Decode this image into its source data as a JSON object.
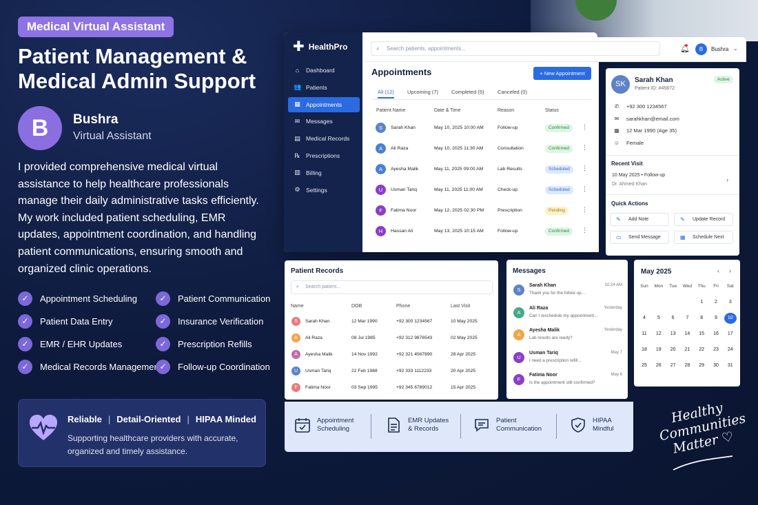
{
  "promo": {
    "tag": "Medical Virtual Assistant",
    "headline": "Patient Management & Medical Admin Support",
    "profile": {
      "initial": "B",
      "name": "Bushra",
      "role": "Virtual Assistant"
    },
    "description": "I provided comprehensive medical virtual assistance to help healthcare professionals manage their daily administrative tasks efficiently. My work included patient scheduling, EMR updates, appointment coordination, and handling patient communications, ensuring smooth and organized clinic operations.",
    "skills": [
      "Appointment Scheduling",
      "Patient Communication",
      "Patient Data Entry",
      "Insurance Verification",
      "EMR / EHR Updates",
      "Prescription Refills",
      "Medical Records Management",
      "Follow-up Coordination"
    ],
    "callout": {
      "traits": [
        "Reliable",
        "Detail-Oriented",
        "HIPAA Minded"
      ],
      "text": "Supporting healthcare providers with accurate, organized and timely assistance."
    },
    "script_text": "Healthy Communities Matter ♡"
  },
  "app": {
    "brand": "HealthPro",
    "nav": [
      {
        "label": "Dashboard",
        "icon": "home-icon",
        "glyph": "⌂"
      },
      {
        "label": "Patients",
        "icon": "users-icon",
        "glyph": "👥"
      },
      {
        "label": "Appointments",
        "icon": "calendar-icon",
        "glyph": "▦"
      },
      {
        "label": "Messages",
        "icon": "mail-icon",
        "glyph": "✉"
      },
      {
        "label": "Medical Records",
        "icon": "file-icon",
        "glyph": "▤"
      },
      {
        "label": "Prescriptions",
        "icon": "rx-icon",
        "glyph": "℞"
      },
      {
        "label": "Billing",
        "icon": "receipt-icon",
        "glyph": "▥"
      },
      {
        "label": "Settings",
        "icon": "gear-icon",
        "glyph": "⚙"
      }
    ],
    "active_nav": "Appointments",
    "search_placeholder": "Search patients, appointments...",
    "user": {
      "initial": "B",
      "name": "Bushra"
    },
    "appointments": {
      "title": "Appointments",
      "new_button": "+ New Appointment",
      "tabs": [
        "All (12)",
        "Upcoming (7)",
        "Completed (5)",
        "Canceled (0)"
      ],
      "columns": [
        "Patient Name",
        "Date & Time",
        "Reason",
        "Status"
      ],
      "rows": [
        {
          "initial": "S",
          "name": "Sarah Khan",
          "datetime": "May 10, 2025 10:00 AM",
          "reason": "Follow-up",
          "status": "Confirmed",
          "color": "#5d82c9"
        },
        {
          "initial": "A",
          "name": "Ali Raza",
          "datetime": "May 10, 2025 11:30 AM",
          "reason": "Consultation",
          "status": "Confirmed",
          "color": "#4a7fd8"
        },
        {
          "initial": "A",
          "name": "Ayesha Malik",
          "datetime": "May 11, 2025 09:00 AM",
          "reason": "Lab Results",
          "status": "Scheduled",
          "color": "#4a7fd8"
        },
        {
          "initial": "U",
          "name": "Usman Tariq",
          "datetime": "May 11, 2025 11:00 AM",
          "reason": "Check-up",
          "status": "Scheduled",
          "color": "#8a3fc7"
        },
        {
          "initial": "F",
          "name": "Fatima Noor",
          "datetime": "May 12, 2025 02:30 PM",
          "reason": "Prescription",
          "status": "Pending",
          "color": "#8a3fc7"
        },
        {
          "initial": "H",
          "name": "Hassan Ali",
          "datetime": "May 13, 2025 10:15 AM",
          "reason": "Follow-up",
          "status": "Confirmed",
          "color": "#8a3fc7"
        }
      ]
    },
    "patient": {
      "initials": "SK",
      "name": "Sarah Khan",
      "id_label": "Patient ID: #45872",
      "status": "Active",
      "info": [
        {
          "icon": "phone-icon",
          "glyph": "✆",
          "text": "+92 300 1234567"
        },
        {
          "icon": "mail-icon",
          "glyph": "✉",
          "text": "sarahkhan@email.com"
        },
        {
          "icon": "calendar-icon",
          "glyph": "▦",
          "text": "12 Mar 1990 (Age 35)"
        },
        {
          "icon": "person-icon",
          "glyph": "☺",
          "text": "Female"
        }
      ],
      "recent_visit_title": "Recent Visit",
      "recent_visit": "10 May 2025 • Follow-up",
      "recent_doctor": "Dr. Ahmed Khan",
      "quick_actions_title": "Quick Actions",
      "quick_actions": [
        {
          "label": "Add Note",
          "icon": "note-icon",
          "glyph": "✎"
        },
        {
          "label": "Update Record",
          "icon": "edit-icon",
          "glyph": "✎"
        },
        {
          "label": "Send Message",
          "icon": "chat-icon",
          "glyph": "▭"
        },
        {
          "label": "Schedule Next",
          "icon": "calendar-icon",
          "glyph": "▦"
        }
      ]
    },
    "records": {
      "title": "Patient Records",
      "search_placeholder": "Search patient...",
      "columns": [
        "Name",
        "DOB",
        "Phone",
        "Last Visit"
      ],
      "rows": [
        {
          "initial": "S",
          "name": "Sarah Khan",
          "dob": "12 Mar 1990",
          "phone": "+92 300 1234567",
          "last": "10 May 2025",
          "color": "#e57d7d"
        },
        {
          "initial": "A",
          "name": "Ali Raza",
          "dob": "08 Jul 1985",
          "phone": "+92 312 9876543",
          "last": "02 May 2025",
          "color": "#f0a64a"
        },
        {
          "initial": "A",
          "name": "Ayesha Malik",
          "dob": "14 Nov 1992",
          "phone": "+92 321 4567890",
          "last": "28 Apr 2025",
          "color": "#c46aa6"
        },
        {
          "initial": "U",
          "name": "Usman Tariq",
          "dob": "22 Feb 1988",
          "phone": "+92 333 1112233",
          "last": "20 Apr 2025",
          "color": "#5d82c9"
        },
        {
          "initial": "F",
          "name": "Fatima Noor",
          "dob": "03 Sep 1995",
          "phone": "+92 345 6789012",
          "last": "15 Apr 2025",
          "color": "#e57d7d"
        }
      ]
    },
    "messages": {
      "title": "Messages",
      "items": [
        {
          "initial": "S",
          "name": "Sarah Khan",
          "text": "Thank you for the follow up...",
          "time": "10:24 AM",
          "color": "#5d82c9"
        },
        {
          "initial": "A",
          "name": "Ali Raza",
          "text": "Can I reschedule my appointment...",
          "time": "Yesterday",
          "color": "#48a98a"
        },
        {
          "initial": "A",
          "name": "Ayesha Malik",
          "text": "Lab results are ready?",
          "time": "Yesterday",
          "color": "#f0a64a"
        },
        {
          "initial": "U",
          "name": "Usman Tariq",
          "text": "I need a prescription refill...",
          "time": "May 7",
          "color": "#8a3fc7"
        },
        {
          "initial": "F",
          "name": "Fatima Noor",
          "text": "Is the appointment still confirmed?",
          "time": "May 6",
          "color": "#8a3fc7"
        }
      ]
    },
    "calendar": {
      "title": "May 2025",
      "weekdays": [
        "Sun",
        "Mon",
        "Tue",
        "Wed",
        "Thu",
        "Fri",
        "Sat"
      ],
      "weeks": [
        [
          "",
          "",
          "",
          "",
          "1",
          "2",
          "3"
        ],
        [
          "4",
          "5",
          "6",
          "7",
          "8",
          "9",
          "10"
        ],
        [
          "11",
          "12",
          "13",
          "14",
          "15",
          "16",
          "17"
        ],
        [
          "18",
          "19",
          "20",
          "21",
          "22",
          "23",
          "24"
        ],
        [
          "25",
          "26",
          "27",
          "28",
          "29",
          "30",
          "31"
        ]
      ],
      "selected": "10"
    },
    "features": [
      {
        "label": "Appointment\nScheduling",
        "icon": "calendar-check-icon"
      },
      {
        "label": "EMR Updates\n& Records",
        "icon": "document-icon"
      },
      {
        "label": "Patient\nCommunication",
        "icon": "chat-icon"
      },
      {
        "label": "HIPAA\nMindful",
        "icon": "shield-check-icon"
      }
    ]
  }
}
